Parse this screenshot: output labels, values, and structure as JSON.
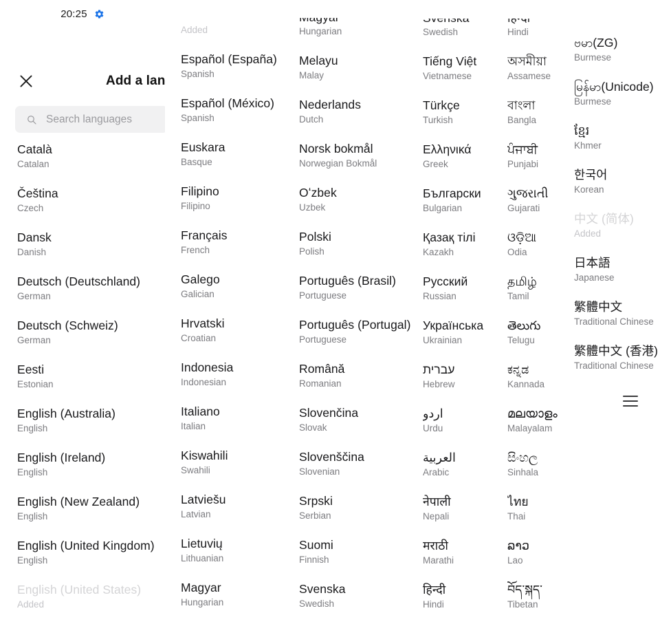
{
  "status_bar": {
    "time": "20:25",
    "icon": "gear-icon",
    "icon_color": "#1a73e8"
  },
  "app_bar": {
    "close_icon": "close-icon",
    "title": "Add a langu"
  },
  "search": {
    "icon": "search-icon",
    "placeholder": "Search languages"
  },
  "labels": {
    "added": "Added"
  },
  "menu": {
    "icon": "hamburger-icon"
  },
  "columns": [
    {
      "id": "column-1",
      "top_orphan": null,
      "items": [
        {
          "native": "Català",
          "sub": "Catalan",
          "state": "available"
        },
        {
          "native": "Čeština",
          "sub": "Czech",
          "state": "available"
        },
        {
          "native": "Dansk",
          "sub": "Danish",
          "state": "available"
        },
        {
          "native": "Deutsch (Deutschland)",
          "sub": "German",
          "state": "available"
        },
        {
          "native": "Deutsch (Schweiz)",
          "sub": "German",
          "state": "available"
        },
        {
          "native": "Eesti",
          "sub": "Estonian",
          "state": "available"
        },
        {
          "native": "English (Australia)",
          "sub": "English",
          "state": "available"
        },
        {
          "native": "English (Ireland)",
          "sub": "English",
          "state": "available"
        },
        {
          "native": "English (New Zealand)",
          "sub": "English",
          "state": "available"
        },
        {
          "native": "English (United Kingdom)",
          "sub": "English",
          "state": "available"
        },
        {
          "native": "English (United States)",
          "sub": "Added",
          "state": "added"
        }
      ]
    },
    {
      "id": "column-2",
      "top_orphan": {
        "sub": "Added",
        "state": "added"
      },
      "items": [
        {
          "native": "Español (España)",
          "sub": "Spanish",
          "state": "available"
        },
        {
          "native": "Español (México)",
          "sub": "Spanish",
          "state": "available"
        },
        {
          "native": "Euskara",
          "sub": "Basque",
          "state": "available"
        },
        {
          "native": "Filipino",
          "sub": "Filipino",
          "state": "available"
        },
        {
          "native": "Français",
          "sub": "French",
          "state": "available"
        },
        {
          "native": "Galego",
          "sub": "Galician",
          "state": "available"
        },
        {
          "native": "Hrvatski",
          "sub": "Croatian",
          "state": "available"
        },
        {
          "native": "Indonesia",
          "sub": "Indonesian",
          "state": "available"
        },
        {
          "native": "Italiano",
          "sub": "Italian",
          "state": "available"
        },
        {
          "native": "Kiswahili",
          "sub": "Swahili",
          "state": "available"
        },
        {
          "native": "Latviešu",
          "sub": "Latvian",
          "state": "available"
        },
        {
          "native": "Lietuvių",
          "sub": "Lithuanian",
          "state": "available"
        },
        {
          "native": "Magyar",
          "sub": "Hungarian",
          "state": "available"
        }
      ]
    },
    {
      "id": "column-3",
      "top_orphan": {
        "native": "Magyar",
        "sub": "Hungarian",
        "state": "available"
      },
      "items": [
        {
          "native": "Melayu",
          "sub": "Malay",
          "state": "available"
        },
        {
          "native": "Nederlands",
          "sub": "Dutch",
          "state": "available"
        },
        {
          "native": "Norsk bokmål",
          "sub": "Norwegian Bokmål",
          "state": "available"
        },
        {
          "native": "Oʻzbek",
          "sub": "Uzbek",
          "state": "available"
        },
        {
          "native": "Polski",
          "sub": "Polish",
          "state": "available"
        },
        {
          "native": "Português (Brasil)",
          "sub": "Portuguese",
          "state": "available"
        },
        {
          "native": "Português (Portugal)",
          "sub": "Portuguese",
          "state": "available"
        },
        {
          "native": "Română",
          "sub": "Romanian",
          "state": "available"
        },
        {
          "native": "Slovenčina",
          "sub": "Slovak",
          "state": "available"
        },
        {
          "native": "Slovenščina",
          "sub": "Slovenian",
          "state": "available"
        },
        {
          "native": "Srpski",
          "sub": "Serbian",
          "state": "available"
        },
        {
          "native": "Suomi",
          "sub": "Finnish",
          "state": "available"
        },
        {
          "native": "Svenska",
          "sub": "Swedish",
          "state": "available"
        }
      ]
    },
    {
      "id": "column-4",
      "top_orphan": {
        "native": "Svenska",
        "sub": "Swedish",
        "state": "available"
      },
      "items": [
        {
          "native": "Tiếng Việt",
          "sub": "Vietnamese",
          "state": "available"
        },
        {
          "native": "Türkçe",
          "sub": "Turkish",
          "state": "available"
        },
        {
          "native": "Ελληνικά",
          "sub": "Greek",
          "state": "available"
        },
        {
          "native": "Български",
          "sub": "Bulgarian",
          "state": "available"
        },
        {
          "native": "Қазақ тілі",
          "sub": "Kazakh",
          "state": "available"
        },
        {
          "native": "Русский",
          "sub": "Russian",
          "state": "available"
        },
        {
          "native": "Українська",
          "sub": "Ukrainian",
          "state": "available"
        },
        {
          "native": "עברית",
          "sub": "Hebrew",
          "state": "available"
        },
        {
          "native": "اردو",
          "sub": "Urdu",
          "state": "available"
        },
        {
          "native": "العربية",
          "sub": "Arabic",
          "state": "available"
        },
        {
          "native": "नेपाली",
          "sub": "Nepali",
          "state": "available"
        },
        {
          "native": "मराठी",
          "sub": "Marathi",
          "state": "available"
        },
        {
          "native": "हिन्दी",
          "sub": "Hindi",
          "state": "available"
        }
      ]
    },
    {
      "id": "column-5",
      "top_orphan": {
        "native": "हिन्दी",
        "sub": "Hindi",
        "state": "available"
      },
      "items": [
        {
          "native": "অসমীয়া",
          "sub": "Assamese",
          "state": "available"
        },
        {
          "native": "বাংলা",
          "sub": "Bangla",
          "state": "available"
        },
        {
          "native": "ਪੰਜਾਬੀ",
          "sub": "Punjabi",
          "state": "available"
        },
        {
          "native": "ગુજરાતી",
          "sub": "Gujarati",
          "state": "available"
        },
        {
          "native": "ଓଡ଼ିଆ",
          "sub": "Odia",
          "state": "available"
        },
        {
          "native": "தமிழ்",
          "sub": "Tamil",
          "state": "available"
        },
        {
          "native": "తెలుగు",
          "sub": "Telugu",
          "state": "available"
        },
        {
          "native": "ಕನ್ನಡ",
          "sub": "Kannada",
          "state": "available"
        },
        {
          "native": "മലയാളം",
          "sub": "Malayalam",
          "state": "available"
        },
        {
          "native": "සිංහල",
          "sub": "Sinhala",
          "state": "available"
        },
        {
          "native": "ไทย",
          "sub": "Thai",
          "state": "available"
        },
        {
          "native": "ລາວ",
          "sub": "Lao",
          "state": "available"
        },
        {
          "native": "བོད་སྐད་",
          "sub": "Tibetan",
          "state": "available"
        }
      ]
    },
    {
      "id": "column-6",
      "top_orphan": null,
      "items": [
        {
          "native": "ဗမာ(ZG)",
          "sub": "Burmese",
          "state": "available"
        },
        {
          "native": "မြန်မာ(Unicode)",
          "sub": "Burmese",
          "state": "available"
        },
        {
          "native": "ខ្មែរ",
          "sub": "Khmer",
          "state": "available"
        },
        {
          "native": "한국어",
          "sub": "Korean",
          "state": "available"
        },
        {
          "native": "中文 (简体)",
          "sub": "Added",
          "state": "added"
        },
        {
          "native": "日本語",
          "sub": "Japanese",
          "state": "available"
        },
        {
          "native": "繁體中文",
          "sub": "Traditional Chinese",
          "state": "available"
        },
        {
          "native": "繁體中文 (香港)",
          "sub": "Traditional Chinese",
          "state": "available"
        }
      ]
    }
  ]
}
